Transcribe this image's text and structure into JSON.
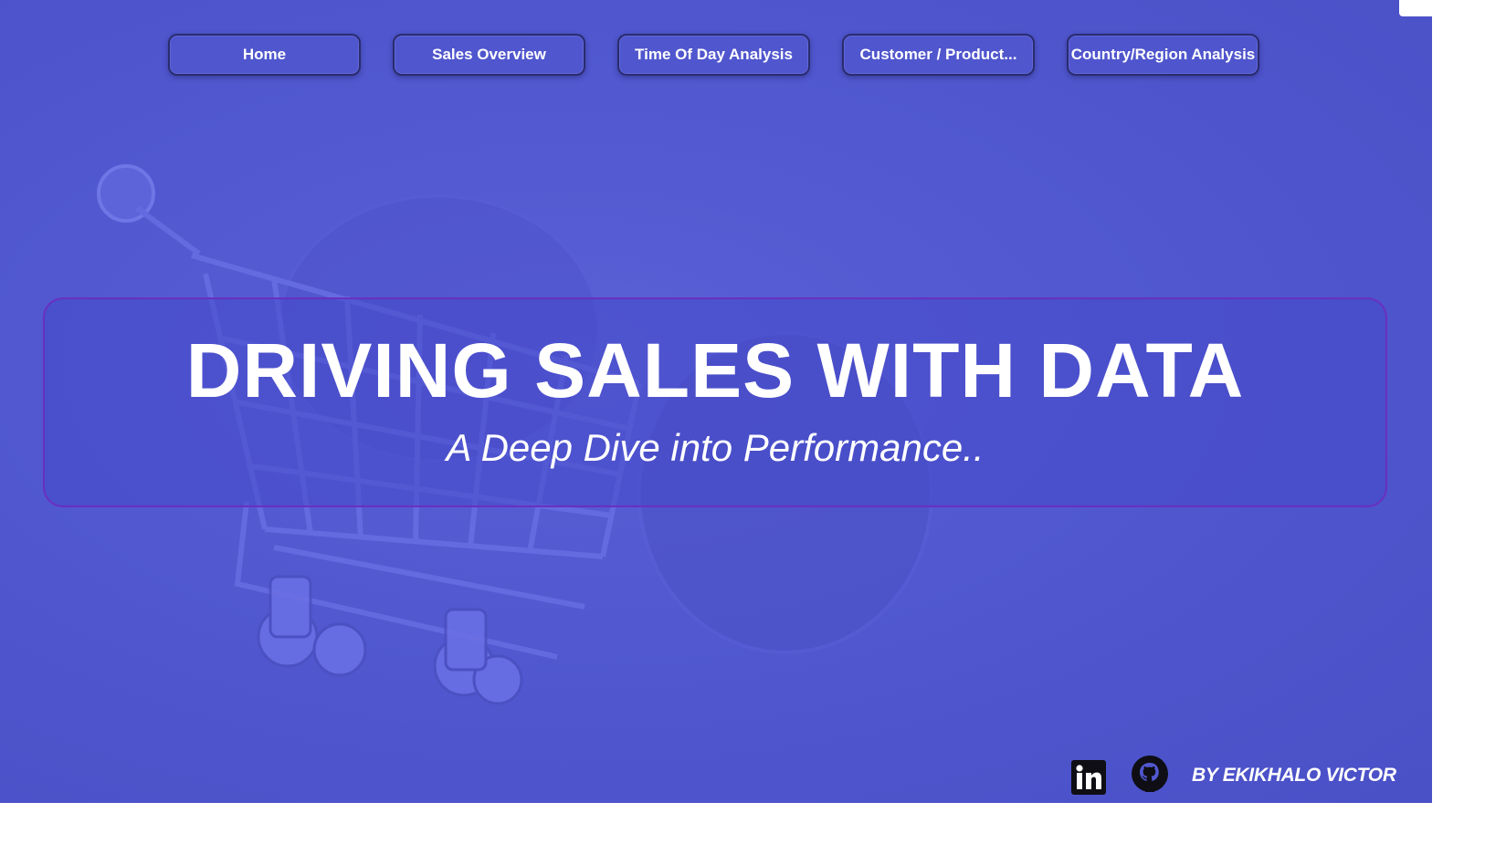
{
  "nav": {
    "items": [
      {
        "label": "Home"
      },
      {
        "label": "Sales Overview"
      },
      {
        "label": "Time Of Day Analysis"
      },
      {
        "label": "Customer / Product..."
      },
      {
        "label": "Country/Region Analysis"
      }
    ]
  },
  "hero": {
    "title": "DRIVING SALES WITH DATA",
    "subtitle": "A Deep Dive into Performance.."
  },
  "footer": {
    "author": "BY EKIKHALO VICTOR",
    "icons": [
      "linkedin-icon",
      "github-icon"
    ]
  },
  "colors": {
    "background": "#5158d0",
    "button_border": "#2a2c6e",
    "hero_border": "#6a2fc0",
    "text": "#ffffff"
  }
}
